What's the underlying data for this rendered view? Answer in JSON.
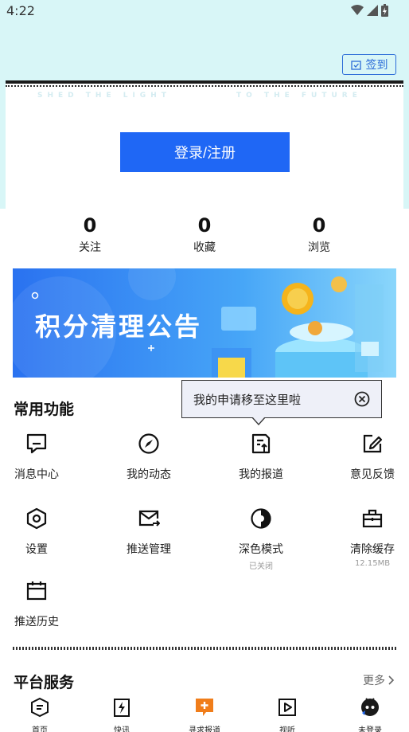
{
  "status_bar": {
    "time": "4:22"
  },
  "header": {
    "checkin_label": "签到",
    "slogan_left": "SHED THE LIGHT",
    "slogan_right": "TO THE FUTURE",
    "login_label": "登录/注册"
  },
  "stats": [
    {
      "value": "0",
      "label": "关注"
    },
    {
      "value": "0",
      "label": "收藏"
    },
    {
      "value": "0",
      "label": "浏览"
    }
  ],
  "banner": {
    "title": "积分清理公告"
  },
  "common": {
    "title": "常用功能",
    "items": [
      {
        "label": "消息中心",
        "icon": "message-icon"
      },
      {
        "label": "我的动态",
        "icon": "compass-icon"
      },
      {
        "label": "我的报道",
        "icon": "report-icon"
      },
      {
        "label": "意见反馈",
        "icon": "edit-icon"
      },
      {
        "label": "设置",
        "icon": "settings-icon"
      },
      {
        "label": "推送管理",
        "icon": "mail-icon"
      },
      {
        "label": "深色模式",
        "icon": "dark-mode-icon",
        "sub": "已关闭"
      },
      {
        "label": "清除缓存",
        "icon": "toolbox-icon",
        "sub": "12.15MB"
      },
      {
        "label": "推送历史",
        "icon": "calendar-icon"
      }
    ]
  },
  "tooltip": {
    "text": "我的申请移至这里啦"
  },
  "platform": {
    "title": "平台服务",
    "more_label": "更多"
  },
  "bottom_nav": [
    {
      "label": "首页"
    },
    {
      "label": "快讯"
    },
    {
      "label": "寻求报道"
    },
    {
      "label": "视听"
    },
    {
      "label": "未登录"
    }
  ],
  "colors": {
    "accent": "#1f67f5",
    "top_bg": "#d8f6f7",
    "nav_accent": "#f07d1a"
  }
}
